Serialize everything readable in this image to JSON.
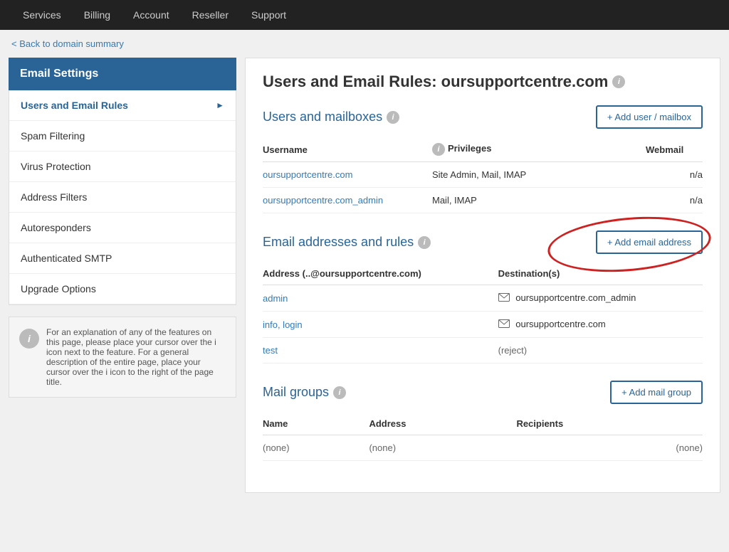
{
  "nav": {
    "items": [
      {
        "label": "Services",
        "id": "services"
      },
      {
        "label": "Billing",
        "id": "billing"
      },
      {
        "label": "Account",
        "id": "account"
      },
      {
        "label": "Reseller",
        "id": "reseller"
      },
      {
        "label": "Support",
        "id": "support"
      }
    ]
  },
  "back_link": "< Back to domain summary",
  "sidebar": {
    "title": "Email Settings",
    "items": [
      {
        "label": "Users and Email Rules",
        "active": true,
        "arrow": true
      },
      {
        "label": "Spam Filtering",
        "active": false,
        "arrow": false
      },
      {
        "label": "Virus Protection",
        "active": false,
        "arrow": false
      },
      {
        "label": "Address Filters",
        "active": false,
        "arrow": false
      },
      {
        "label": "Autoresponders",
        "active": false,
        "arrow": false
      },
      {
        "label": "Authenticated SMTP",
        "active": false,
        "arrow": false
      },
      {
        "label": "Upgrade Options",
        "active": false,
        "arrow": false
      }
    ],
    "info_text": "For an explanation of any of the features on this page, please place your cursor over the i icon next to the feature. For a general description of the entire page, place your cursor over the i icon to the right of the page title."
  },
  "main": {
    "page_title": "Users and Email Rules: oursupportcentre.com",
    "users_section": {
      "title": "Users and mailboxes",
      "add_button": "+ Add user / mailbox",
      "columns": [
        "Username",
        "Privileges",
        "Webmail"
      ],
      "rows": [
        {
          "username": "oursupportcentre.com",
          "username_link": true,
          "privileges": "Site Admin, Mail, IMAP",
          "webmail": "n/a"
        },
        {
          "username": "oursupportcentre.com_admin",
          "username_link": true,
          "privileges": "Mail, IMAP",
          "webmail": "n/a"
        }
      ]
    },
    "email_section": {
      "title": "Email addresses and rules",
      "add_button": "+ Add email address",
      "columns": [
        "Address (..@oursupportcentre.com)",
        "Destination(s)"
      ],
      "rows": [
        {
          "address": "admin",
          "destination": "oursupportcentre.com_admin",
          "has_icon": true
        },
        {
          "address": "info, login",
          "destination": "oursupportcentre.com",
          "has_icon": true
        },
        {
          "address": "test",
          "destination": "(reject)",
          "has_icon": false
        }
      ]
    },
    "mail_groups_section": {
      "title": "Mail groups",
      "add_button": "+ Add mail group",
      "columns": [
        "Name",
        "Address",
        "Recipients"
      ],
      "rows": [
        {
          "name": "(none)",
          "address": "(none)",
          "recipients": "(none)"
        }
      ]
    }
  }
}
